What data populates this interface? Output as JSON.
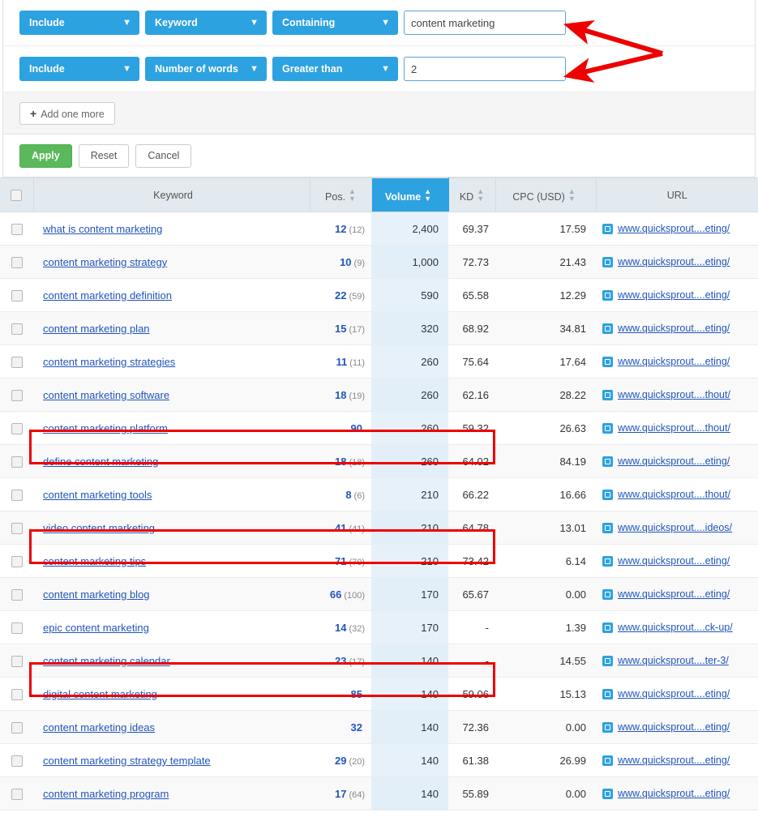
{
  "filters": {
    "rows": [
      {
        "scope": "Include",
        "field": "Keyword",
        "operator": "Containing",
        "value": "content marketing",
        "chevron_icon": "chevron-down-icon"
      },
      {
        "scope": "Include",
        "field": "Number of words",
        "operator": "Greater than",
        "value": "2",
        "chevron_icon": "chevron-down-icon"
      }
    ],
    "add_one_more_label": "Add one more",
    "add_icon": "plus-icon",
    "apply_label": "Apply",
    "reset_label": "Reset",
    "cancel_label": "Cancel"
  },
  "table": {
    "headers": {
      "checkbox": "",
      "keyword": "Keyword",
      "position": "Pos.",
      "volume": "Volume",
      "kd": "KD",
      "cpc": "CPC (USD)",
      "url": "URL"
    },
    "sort_icon": "sort-arrows-icon",
    "active_sort_column": "Volume",
    "rows": [
      {
        "keyword": "what is content marketing",
        "pos": "12",
        "pos_prev": "(12)",
        "volume": "2,400",
        "kd": "69.37",
        "cpc": "17.59",
        "url": "www.quicksprout....eting/",
        "highlighted": false
      },
      {
        "keyword": "content marketing strategy",
        "pos": "10",
        "pos_prev": "(9)",
        "volume": "1,000",
        "kd": "72.73",
        "cpc": "21.43",
        "url": "www.quicksprout....eting/",
        "highlighted": false
      },
      {
        "keyword": "content marketing definition",
        "pos": "22",
        "pos_prev": "(59)",
        "volume": "590",
        "kd": "65.58",
        "cpc": "12.29",
        "url": "www.quicksprout....eting/",
        "highlighted": false
      },
      {
        "keyword": "content marketing plan",
        "pos": "15",
        "pos_prev": "(17)",
        "volume": "320",
        "kd": "68.92",
        "cpc": "34.81",
        "url": "www.quicksprout....eting/",
        "highlighted": false
      },
      {
        "keyword": "content marketing strategies",
        "pos": "11",
        "pos_prev": "(11)",
        "volume": "260",
        "kd": "75.64",
        "cpc": "17.64",
        "url": "www.quicksprout....eting/",
        "highlighted": false
      },
      {
        "keyword": "content marketing software",
        "pos": "18",
        "pos_prev": "(19)",
        "volume": "260",
        "kd": "62.16",
        "cpc": "28.22",
        "url": "www.quicksprout....thout/",
        "highlighted": false
      },
      {
        "keyword": "content marketing platform",
        "pos": "90",
        "pos_prev": "",
        "volume": "260",
        "kd": "59.32",
        "cpc": "26.63",
        "url": "www.quicksprout....thout/",
        "highlighted": true
      },
      {
        "keyword": "define content marketing",
        "pos": "18",
        "pos_prev": "(18)",
        "volume": "260",
        "kd": "64.02",
        "cpc": "84.19",
        "url": "www.quicksprout....eting/",
        "highlighted": false
      },
      {
        "keyword": "content marketing tools",
        "pos": "8",
        "pos_prev": "(6)",
        "volume": "210",
        "kd": "66.22",
        "cpc": "16.66",
        "url": "www.quicksprout....thout/",
        "highlighted": false
      },
      {
        "keyword": "video content marketing",
        "pos": "41",
        "pos_prev": "(41)",
        "volume": "210",
        "kd": "64.78",
        "cpc": "13.01",
        "url": "www.quicksprout....ideos/",
        "highlighted": true
      },
      {
        "keyword": "content marketing tips",
        "pos": "71",
        "pos_prev": "(70)",
        "volume": "210",
        "kd": "73.42",
        "cpc": "6.14",
        "url": "www.quicksprout....eting/",
        "highlighted": false
      },
      {
        "keyword": "content marketing blog",
        "pos": "66",
        "pos_prev": "(100)",
        "volume": "170",
        "kd": "65.67",
        "cpc": "0.00",
        "url": "www.quicksprout....eting/",
        "highlighted": false
      },
      {
        "keyword": "epic content marketing",
        "pos": "14",
        "pos_prev": "(32)",
        "volume": "170",
        "kd": "-",
        "cpc": "1.39",
        "url": "www.quicksprout....ck-up/",
        "highlighted": false
      },
      {
        "keyword": "content marketing calendar",
        "pos": "23",
        "pos_prev": "(17)",
        "volume": "140",
        "kd": "-",
        "cpc": "14.55",
        "url": "www.quicksprout....ter-3/",
        "highlighted": true
      },
      {
        "keyword": "digital content marketing",
        "pos": "85",
        "pos_prev": "",
        "volume": "140",
        "kd": "59.06",
        "cpc": "15.13",
        "url": "www.quicksprout....eting/",
        "highlighted": false
      },
      {
        "keyword": "content marketing ideas",
        "pos": "32",
        "pos_prev": "",
        "volume": "140",
        "kd": "72.36",
        "cpc": "0.00",
        "url": "www.quicksprout....eting/",
        "highlighted": false
      },
      {
        "keyword": "content marketing strategy template",
        "pos": "29",
        "pos_prev": "(20)",
        "volume": "140",
        "kd": "61.38",
        "cpc": "26.99",
        "url": "www.quicksprout....eting/",
        "highlighted": false
      },
      {
        "keyword": "content marketing program",
        "pos": "17",
        "pos_prev": "(64)",
        "volume": "140",
        "kd": "55.89",
        "cpc": "0.00",
        "url": "www.quicksprout....eting/",
        "highlighted": false
      }
    ]
  },
  "annotations": {
    "arrow_color": "#ee0000",
    "highlight_color": "#ee0000",
    "arrows": [
      {
        "name": "arrow-to-keyword-input"
      },
      {
        "name": "arrow-to-number-input"
      }
    ]
  },
  "colors": {
    "dropdown_blue": "#2da2e0",
    "apply_green": "#5cb85c",
    "link_blue": "#2255bb",
    "volume_tint": "#e6f1fa"
  }
}
